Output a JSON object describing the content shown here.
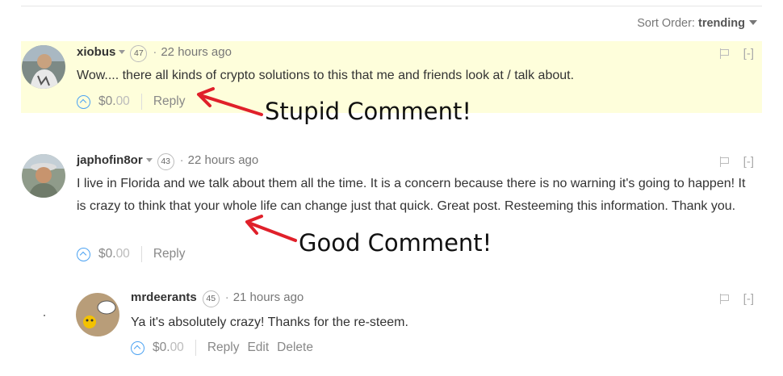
{
  "sort": {
    "label": "Sort Order:",
    "value": "trending"
  },
  "comments": [
    {
      "author": "xiobus",
      "reputation": "47",
      "time": "22 hours ago",
      "body": "Wow.... there all kinds of crypto solutions to this that me and friends look at / talk about.",
      "amount_main": "$0.",
      "amount_cents": "00",
      "reply": "Reply",
      "collapse": "[-]"
    },
    {
      "author": "japhofin8or",
      "reputation": "43",
      "time": "22 hours ago",
      "body": "I live in Florida and we talk about them all the time. It is a concern because there is no warning it's going to happen! It is crazy to think that your whole life can change just that quick. Great post. Resteeming this information. Thank you.",
      "amount_main": "$0.",
      "amount_cents": "00",
      "reply": "Reply",
      "collapse": "[-]"
    },
    {
      "author": "mrdeerants",
      "reputation": "45",
      "time": "21 hours ago",
      "body": "Ya it's absolutely crazy! Thanks for the re-steem.",
      "amount_main": "$0.",
      "amount_cents": "00",
      "reply": "Reply",
      "edit": "Edit",
      "delete": "Delete",
      "collapse": "[-]"
    }
  ],
  "annotations": {
    "first": "Stupid Comment!",
    "second": "Good Comment!"
  },
  "colors": {
    "highlight": "#fefedb",
    "upvote": "#4ba2f2",
    "arrow": "#e0202a"
  }
}
